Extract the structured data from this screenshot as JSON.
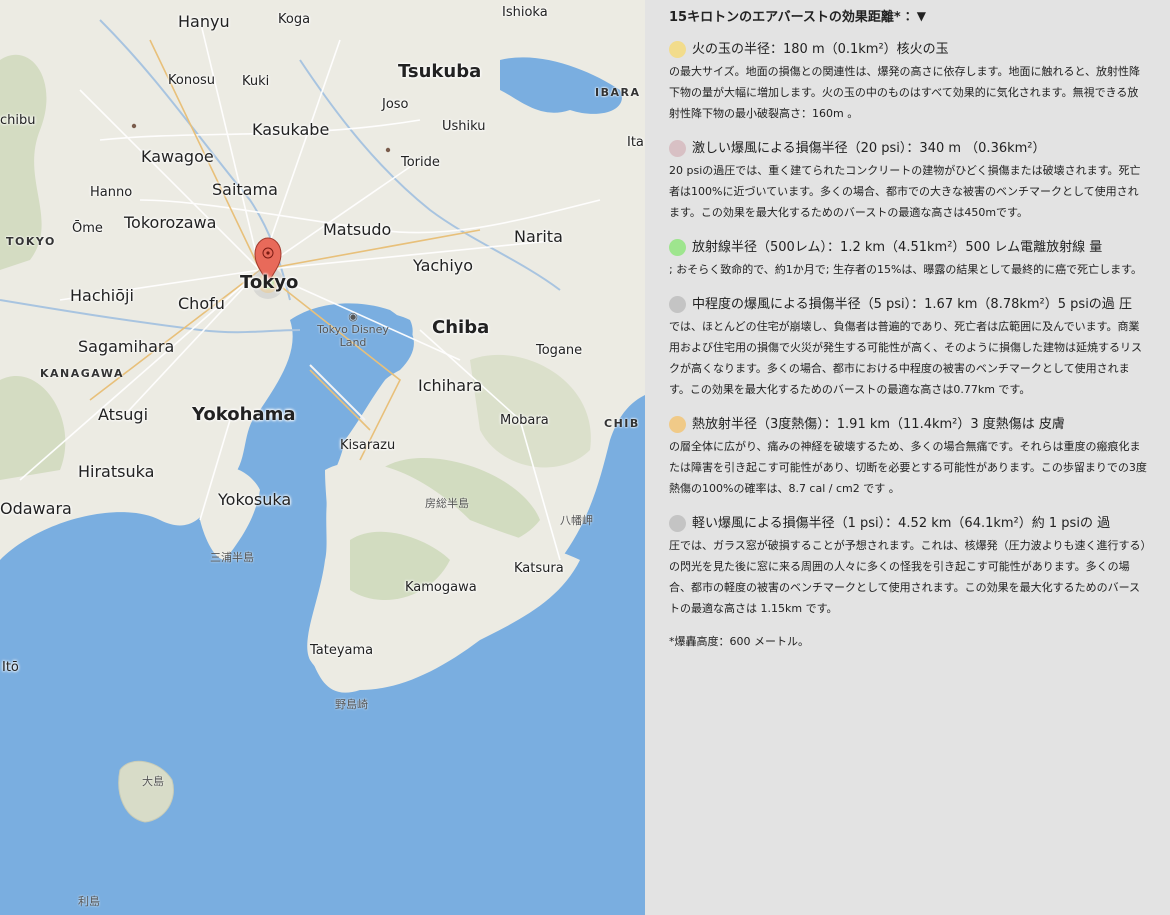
{
  "map": {
    "cities": {
      "hanyu": "Hanyu",
      "koga": "Koga",
      "ishioka": "Ishioka",
      "konosu": "Konosu",
      "kuki": "Kuki",
      "tsukuba": "Tsukuba",
      "joso": "Joso",
      "ushiku": "Ushiku",
      "kasukabe": "Kasukabe",
      "chibu": "chibu",
      "kawagoe": "Kawagoe",
      "toride": "Toride",
      "hanno": "Hanno",
      "saitama": "Saitama",
      "tokorozawa": "Tokorozawa",
      "ome": "Ōme",
      "matsudo": "Matsudo",
      "narita": "Narita",
      "yachiyo": "Yachiyo",
      "tokyo": "Tokyo",
      "hachioji": "Hachiōji",
      "chofu": "Chofu",
      "chiba": "Chiba",
      "sagamihara": "Sagamihara",
      "togane": "Togane",
      "ichihara": "Ichihara",
      "atsugi": "Atsugi",
      "yokohama": "Yokohama",
      "mobara": "Mobara",
      "kisarazu": "Kisarazu",
      "hiratsuka": "Hiratsuka",
      "yokosuka": "Yokosuka",
      "odawara": "Odawara",
      "katsura": "Katsura",
      "kamogawa": "Kamogawa",
      "tateyama": "Tateyama",
      "ito": "Itō",
      "ita": "Ita"
    },
    "regions": {
      "tokyo": "TOKYO",
      "kanagawa": "KANAGAWA",
      "ibaraki": "IBARA",
      "chiba": "CHIB"
    },
    "jp_labels": {
      "boso": "房総半島",
      "miura": "三浦半島",
      "hachiman": "八幡岬",
      "nojima": "野島崎",
      "oshima": "大島",
      "toshima": "利島"
    },
    "poi": {
      "disney": "Tokyo Disney Land"
    }
  },
  "panel": {
    "title": "15キロトンのエアバーストの効果距離*",
    "title_suffix": "：▼",
    "colors": {
      "fireball": "#f2dc8c",
      "heavy": "#d8c0c4",
      "radiation": "#9ee58e",
      "moderate": "#c4c4c4",
      "thermal": "#f0ca88",
      "light": "#c4c4c4"
    },
    "effects": [
      {
        "head": "火の玉の半径：180 m（0.1km²）核火の玉",
        "desc": "の最大サイズ。地面の損傷との関連性は、爆発の高さに依存します。地面に触れると、放射性降下物の量が大幅に増加します。火の玉の中のものはすべて効果的に気化されます。無視できる放射性降下物の最小破裂高さ：160m 。"
      },
      {
        "head": "激しい爆風による損傷半径（20 psi）：340 m （0.36km²）",
        "desc": "20 psiの過圧では、重く建てられたコンクリートの建物がひどく損傷または破壊されます。死亡者は100%に近づいています。多くの場合、都市での大きな被害のベンチマークとして使用されます。この効果を最大化するためのバーストの最適な高さは450mです。"
      },
      {
        "head": "放射線半径（500レム）：1.2 km（4.51km²）500 レム電離放射線 量",
        "desc": "; おそらく致命的で、約1か月で; 生存者の15%は、曝露の結果として最終的に癌で死亡します。"
      },
      {
        "head": "中程度の爆風による損傷半径（5 psi）：1.67 km（8.78km²）5 psiの過 圧",
        "desc": "では、ほとんどの住宅が崩壊し、負傷者は普遍的であり、死亡者は広範囲に及んでいます。商業用および住宅用の損傷で火災が発生する可能性が高く、そのように損傷した建物は延焼するリスクが高くなります。多くの場合、都市における中程度の被害のベンチマークとして使用されます。この効果を最大化するためのバーストの最適な高さは0.77km です。"
      },
      {
        "head": "熱放射半径（3度熱傷）：1.91 km（11.4km²）3 度熱傷は 皮膚",
        "desc": "の層全体に広がり、痛みの神経を破壊するため、多くの場合無痛です。それらは重度の瘢痕化または障害を引き起こす可能性があり、切断を必要とする可能性があります。この歩留まりでの3度熱傷の100%の確率は、8.7 cal / cm2 です 。"
      },
      {
        "head": "軽い爆風による損傷半径（1 psi）：4.52 km（64.1km²）約 1 psiの 過",
        "desc": "圧では、ガラス窓が破損することが予想されます。これは、核爆発（圧力波よりも速く進行する）の閃光を見た後に窓に来る周囲の人々に多くの怪我を引き起こす可能性があります。多くの場合、都市の軽度の被害のベンチマークとして使用されます。この効果を最大化するためのバーストの最適な高さは 1.15km です。"
      }
    ],
    "footnote": "*爆轟高度：600 メートル。"
  }
}
